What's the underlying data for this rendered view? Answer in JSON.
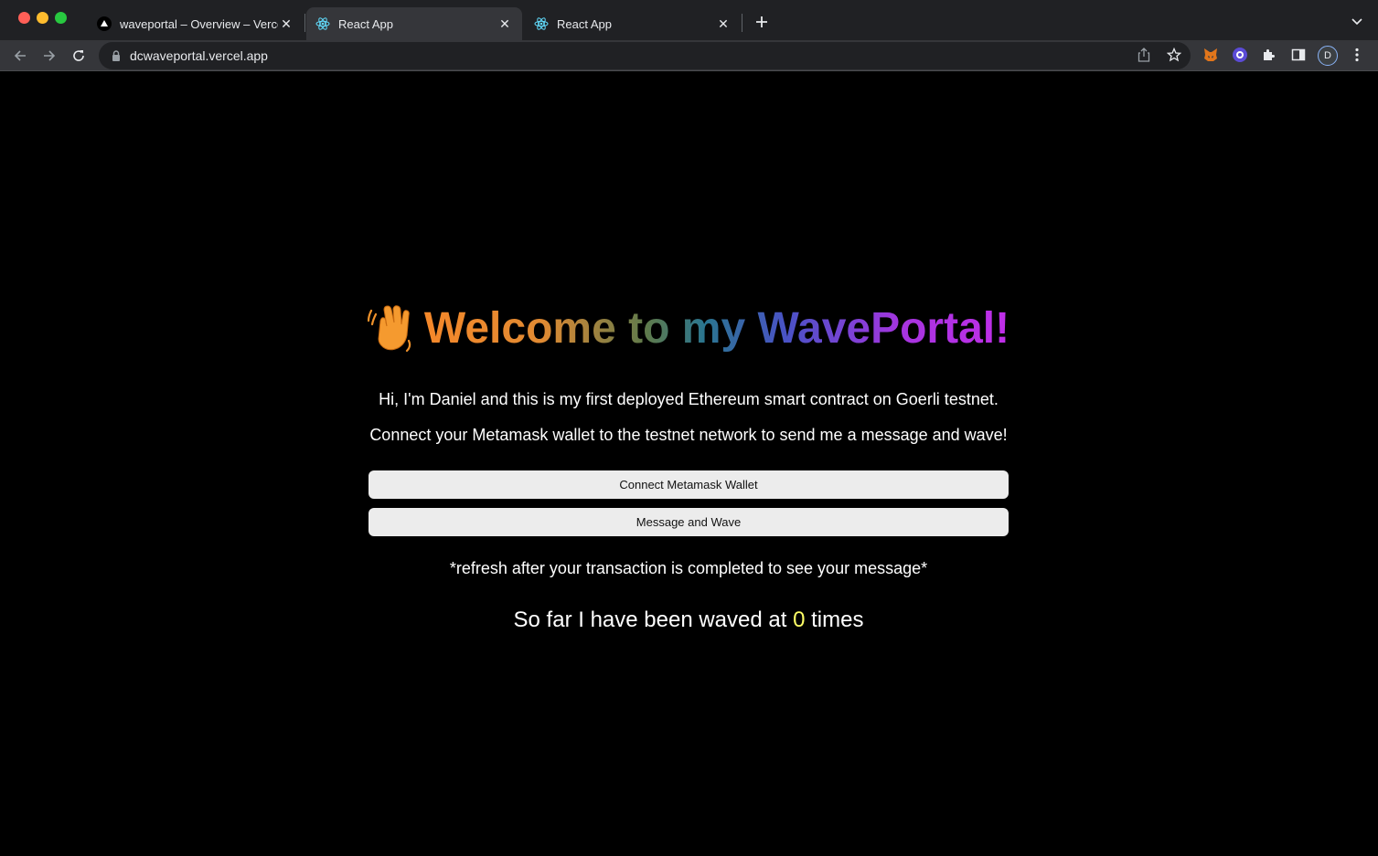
{
  "browser": {
    "tabs": [
      {
        "title": "waveportal – Overview – Vercel",
        "favicon": "vercel-triangle-icon",
        "active": false
      },
      {
        "title": "React App",
        "favicon": "react-icon",
        "active": true
      },
      {
        "title": "React App",
        "favicon": "react-icon",
        "active": false
      }
    ],
    "url": "dcwaveportal.vercel.app",
    "profile_initial": "D"
  },
  "page": {
    "heading": "Welcome to my WavePortal!",
    "heading_emoji": "waving-hand-icon",
    "intro": "Hi, I'm Daniel and this is my first deployed Ethereum smart contract on Goerli testnet.",
    "instructions": "Connect your Metamask wallet to the testnet network to send me a message and wave!",
    "connect_button": "Connect Metamask Wallet",
    "wave_button": "Message and Wave",
    "refresh_note": "*refresh after your transaction is completed to see your message*",
    "counter_prefix": "So far I have been waved at",
    "wave_count": "0",
    "counter_suffix": "times"
  },
  "colors": {
    "page_background": "#000000",
    "count_highlight": "#ffff66",
    "heading_gradient_start": "#f5882a",
    "heading_gradient_end": "#c02ee8"
  }
}
